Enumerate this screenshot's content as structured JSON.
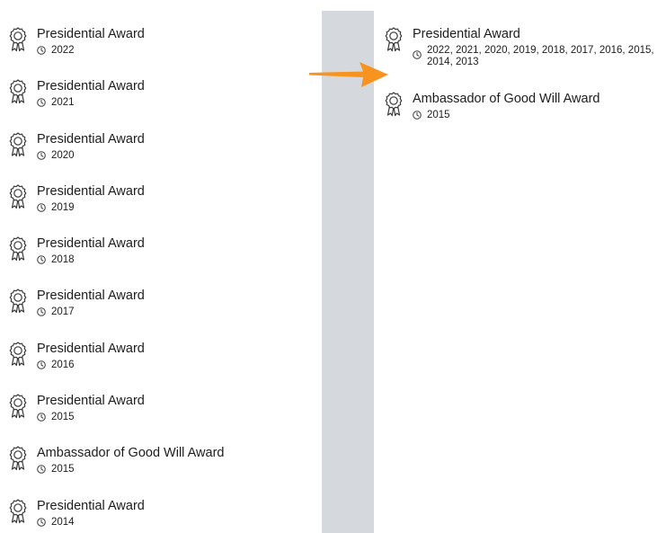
{
  "left_list": {
    "items": [
      {
        "title": "Presidential Award",
        "years": "2022"
      },
      {
        "title": "Presidential Award",
        "years": "2021"
      },
      {
        "title": "Presidential Award",
        "years": "2020"
      },
      {
        "title": "Presidential Award",
        "years": "2019"
      },
      {
        "title": "Presidential Award",
        "years": "2018"
      },
      {
        "title": "Presidential Award",
        "years": "2017"
      },
      {
        "title": "Presidential Award",
        "years": "2016"
      },
      {
        "title": "Presidential Award",
        "years": "2015"
      },
      {
        "title": "Ambassador of Good Will Award",
        "years": "2015"
      },
      {
        "title": "Presidential Award",
        "years": "2014"
      }
    ]
  },
  "right_list": {
    "items": [
      {
        "title": "Presidential Award",
        "years": "2022, 2021, 2020, 2019, 2018, 2017, 2016, 2015, 2014, 2013"
      },
      {
        "title": "Ambassador of Good Will Award",
        "years": "2015"
      }
    ]
  },
  "icons": {
    "award": "award-ribbon-icon",
    "clock": "clock-icon",
    "arrow": "arrow-right-icon"
  },
  "colors": {
    "arrow": "#f7931e",
    "divider_band": "#d5d9dd",
    "text": "#1c1c1e"
  }
}
